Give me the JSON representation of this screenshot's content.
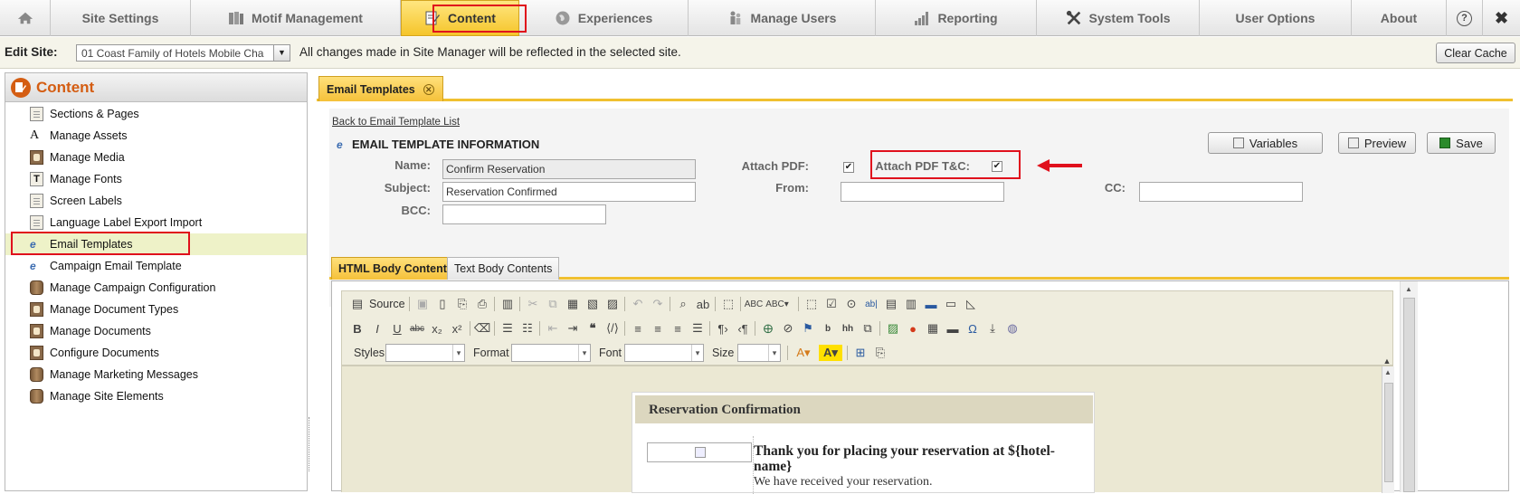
{
  "nav": {
    "items": [
      {
        "key": "home",
        "label": "",
        "icon": "home-icon"
      },
      {
        "key": "site_settings",
        "label": "Site Settings",
        "icon": ""
      },
      {
        "key": "motif",
        "label": "Motif Management",
        "icon": "books-icon"
      },
      {
        "key": "content",
        "label": "Content",
        "icon": "content-edit-icon"
      },
      {
        "key": "experiences",
        "label": "Experiences",
        "icon": "globe-icon"
      },
      {
        "key": "manage_users",
        "label": "Manage Users",
        "icon": "users-icon"
      },
      {
        "key": "reporting",
        "label": "Reporting",
        "icon": "bar-chart-icon"
      },
      {
        "key": "system_tools",
        "label": "System Tools",
        "icon": "tools-icon"
      },
      {
        "key": "user_options",
        "label": "User Options",
        "icon": ""
      },
      {
        "key": "about",
        "label": "About",
        "icon": ""
      }
    ],
    "help_icon": "?",
    "close_icon": "✖",
    "active_color": "#f5c52a"
  },
  "sitebar": {
    "label": "Edit Site:",
    "site_value": "01 Coast Family of Hotels Mobile Cha",
    "notice": "All changes made in Site Manager will be reflected in the selected site.",
    "clear_cache": "Clear Cache"
  },
  "sidebar": {
    "title": "Content",
    "items": [
      {
        "label": "Sections & Pages",
        "icon": "doc"
      },
      {
        "label": "Manage Assets",
        "icon": "asset"
      },
      {
        "label": "Manage Media",
        "icon": "media"
      },
      {
        "label": "Manage Fonts",
        "icon": "font"
      },
      {
        "label": "Screen Labels",
        "icon": "doc"
      },
      {
        "label": "Language Label Export Import",
        "icon": "doc"
      },
      {
        "label": "Email Templates",
        "icon": "e"
      },
      {
        "label": "Campaign Email Template",
        "icon": "e"
      },
      {
        "label": "Manage Campaign Configuration",
        "icon": "cyl"
      },
      {
        "label": "Manage Document Types",
        "icon": "media"
      },
      {
        "label": "Manage Documents",
        "icon": "media"
      },
      {
        "label": "Configure Documents",
        "icon": "media"
      },
      {
        "label": "Manage Marketing Messages",
        "icon": "cyl"
      },
      {
        "label": "Manage Site Elements",
        "icon": "cyl"
      }
    ]
  },
  "main": {
    "tab_label": "Email Templates",
    "back_link": "Back to Email Template List",
    "section_title": "EMAIL TEMPLATE INFORMATION",
    "labels": {
      "name": "Name:",
      "subject": "Subject:",
      "bcc": "BCC:",
      "attach_pdf": "Attach PDF:",
      "attach_pdf_tc": "Attach PDF T&C:",
      "from": "From:",
      "cc": "CC:"
    },
    "values": {
      "name": "Confirm Reservation",
      "subject": "Reservation Confirmed",
      "bcc": "",
      "from": "",
      "cc": "",
      "attach_pdf_checked": "✔",
      "attach_pdf_tc_checked": "✔"
    },
    "buttons": {
      "variables": "Variables",
      "preview": "Preview",
      "save": "Save"
    },
    "body_tabs": [
      "HTML Body Contents",
      "Text Body Contents"
    ],
    "editor": {
      "source_label": "Source",
      "styles_label": "Styles",
      "format_label": "Format",
      "font_label": "Font",
      "size_label": "Size"
    },
    "preview": {
      "heading": "Reservation Confirmation",
      "thanks": "Thank you for placing your reservation at ${hotel-name}",
      "received": "We have received your reservation."
    }
  },
  "annotation_color": "#e0101c"
}
